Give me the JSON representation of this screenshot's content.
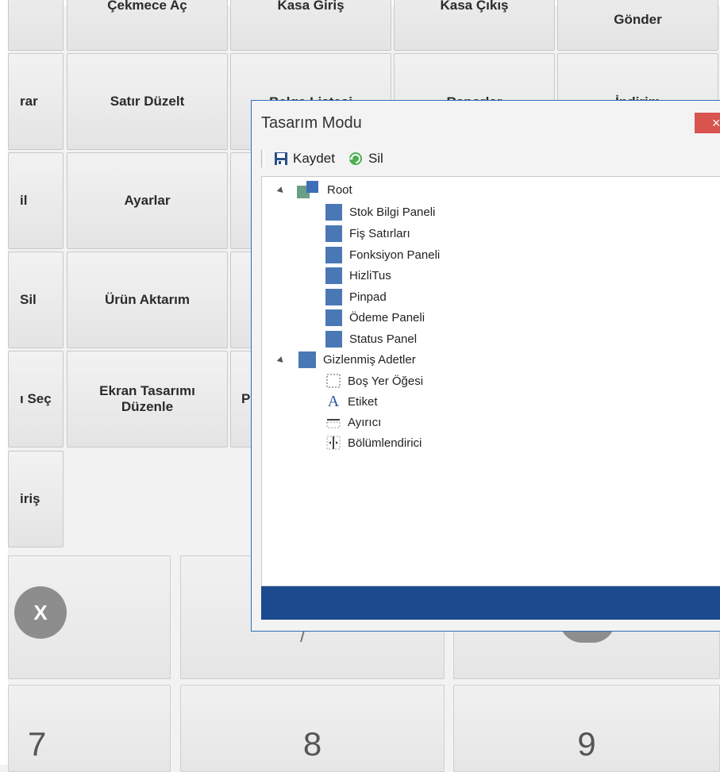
{
  "function_buttons": {
    "row1": [
      "Çekmece Aç",
      "Kasa Giriş",
      "Kasa Çıkış",
      "Gönder"
    ],
    "row2_left": "rar",
    "row2": [
      "Satır Düzelt",
      "Belge Listesi",
      "Raporlar",
      "İndirim"
    ],
    "row3_left": "il",
    "row3": [
      "Ayarlar"
    ],
    "row4_left": "Sil",
    "row4": [
      "Ürün Aktarım"
    ],
    "row5_left": "ı Seç",
    "row5": [
      "Ekran Tasarımı Düzenle",
      "P"
    ],
    "row6_left": "iriş"
  },
  "numpad": {
    "clear": "X",
    "keys": [
      "7",
      "8",
      "9"
    ]
  },
  "dialog": {
    "title": "Tasarım Modu",
    "close": "×",
    "toolbar": {
      "save_label": "Kaydet",
      "delete_label": "Sil"
    },
    "tree": {
      "root": "Root",
      "root_items": [
        "Stok Bilgi Paneli",
        "Fiş Satırları",
        "Fonksiyon Paneli",
        "HizliTus",
        "Pinpad",
        "Ödeme Paneli",
        "Status Panel"
      ],
      "hidden_group": "Gizlenmiş Adetler",
      "hidden_items": [
        {
          "label": "Boş Yer Öğesi",
          "icon": "empty-space-icon"
        },
        {
          "label": "Etiket",
          "icon": "label-icon"
        },
        {
          "label": "Ayırıcı",
          "icon": "separator-icon"
        },
        {
          "label": "Bölümlendirici",
          "icon": "splitter-icon"
        }
      ]
    }
  },
  "colors": {
    "accent": "#1c4a8f",
    "tree_item": "#4a78b4",
    "close": "#d9534f"
  }
}
